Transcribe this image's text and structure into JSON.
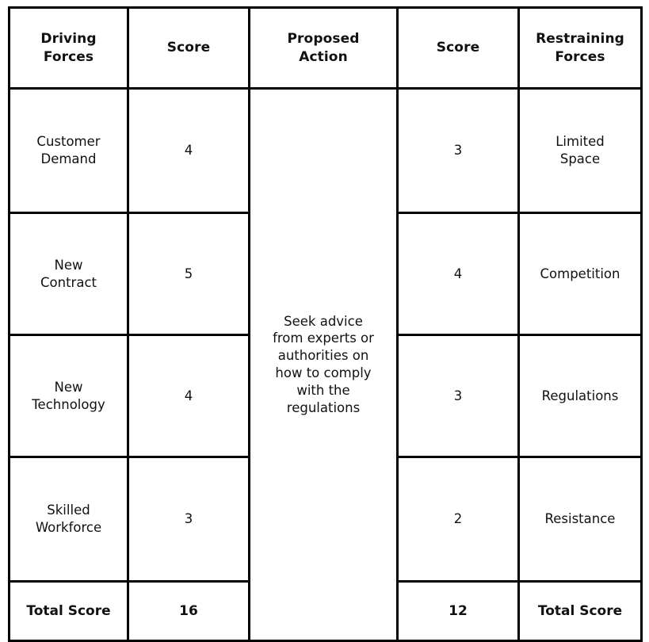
{
  "table": {
    "headers": [
      "Driving\nForces",
      "Score",
      "Proposed\nAction",
      "Score",
      "Restraining\nForces"
    ],
    "proposed_action": "Seek advice\nfrom experts or\nauthorities on\nhow to comply\nwith the\nregulations",
    "rows": [
      {
        "driving_force": "Customer\nDemand",
        "driving_score": "4",
        "restraining_score": "3",
        "restraining_force": "Limited\nSpace"
      },
      {
        "driving_force": "New\nContract",
        "driving_score": "5",
        "restraining_score": "4",
        "restraining_force": "Competition"
      },
      {
        "driving_force": "New\nTechnology",
        "driving_score": "4",
        "restraining_score": "3",
        "restraining_force": "Regulations"
      },
      {
        "driving_force": "Skilled\nWorkforce",
        "driving_score": "3",
        "restraining_score": "2",
        "restraining_force": "Resistance"
      }
    ],
    "total_row": {
      "driving_label": "Total Score",
      "driving_total": "16",
      "restraining_total": "12",
      "restraining_label": "Total Score"
    },
    "colors": {
      "border": "#000000",
      "background": "#ffffff",
      "text": "#111111"
    }
  }
}
